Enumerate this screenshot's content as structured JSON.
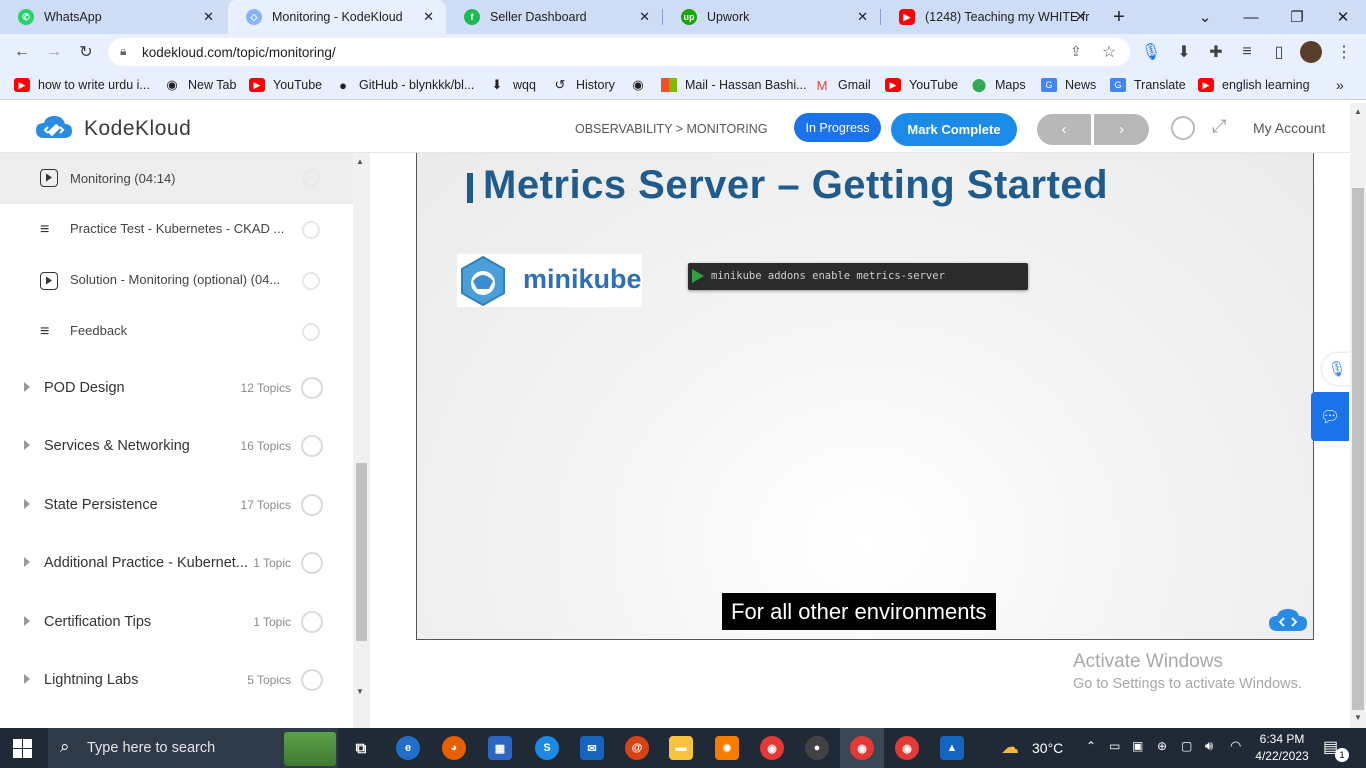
{
  "browser": {
    "tabs": [
      {
        "title": "WhatsApp",
        "active": false
      },
      {
        "title": "Monitoring - KodeKloud",
        "active": true
      },
      {
        "title": "Seller Dashboard",
        "active": false
      },
      {
        "title": "Upwork",
        "active": false
      },
      {
        "title": "(1248) Teaching my WHITE fr",
        "active": false
      }
    ],
    "new_tab_symbol": "+",
    "url": "kodekloud.com/topic/monitoring/",
    "bookmarks": [
      "how to write urdu i...",
      "New Tab",
      "YouTube",
      "GitHub - blynkkk/bl...",
      "wqq",
      "History",
      "Mail - Hassan Bashi...",
      "Gmail",
      "YouTube",
      "Maps",
      "News",
      "Translate",
      "english learning"
    ]
  },
  "header": {
    "logo_text": "KodeKloud",
    "breadcrumb": "OBSERVABILITY > MONITORING",
    "status_badge": "In Progress",
    "mark_complete": "Mark Complete",
    "account": "My Account"
  },
  "sidebar": {
    "lessons": [
      {
        "title": "Monitoring (04:14)",
        "type": "video",
        "current": true
      },
      {
        "title": "Practice Test - Kubernetes - CKAD ...",
        "type": "lab",
        "current": false
      },
      {
        "title": "Solution - Monitoring (optional) (04...",
        "type": "video",
        "current": false
      },
      {
        "title": "Feedback",
        "type": "lab",
        "current": false
      }
    ],
    "sections": [
      {
        "title": "POD Design",
        "count": "12 Topics"
      },
      {
        "title": "Services & Networking",
        "count": "16 Topics"
      },
      {
        "title": "State Persistence",
        "count": "17 Topics"
      },
      {
        "title": "Additional Practice - Kubernet...",
        "count": "1 Topic"
      },
      {
        "title": "Certification Tips",
        "count": "1 Topic"
      },
      {
        "title": "Lightning Labs",
        "count": "5 Topics"
      }
    ]
  },
  "video": {
    "slide_title": "Metrics Server – Getting Started",
    "minikube_label": "minikube",
    "command": "minikube addons enable metrics-server",
    "caption": "For all other environments"
  },
  "watermark": {
    "line1": "Activate Windows",
    "line2": "Go to Settings to activate Windows."
  },
  "taskbar": {
    "search_placeholder": "Type here to search",
    "weather": "30°C",
    "time": "6:34 PM",
    "date": "4/22/2023",
    "notification_count": "1"
  },
  "colors": {
    "accent_blue": "#1a73e8",
    "kodekloud_blue": "#2a8be3",
    "slide_title": "#1f5c8b"
  }
}
